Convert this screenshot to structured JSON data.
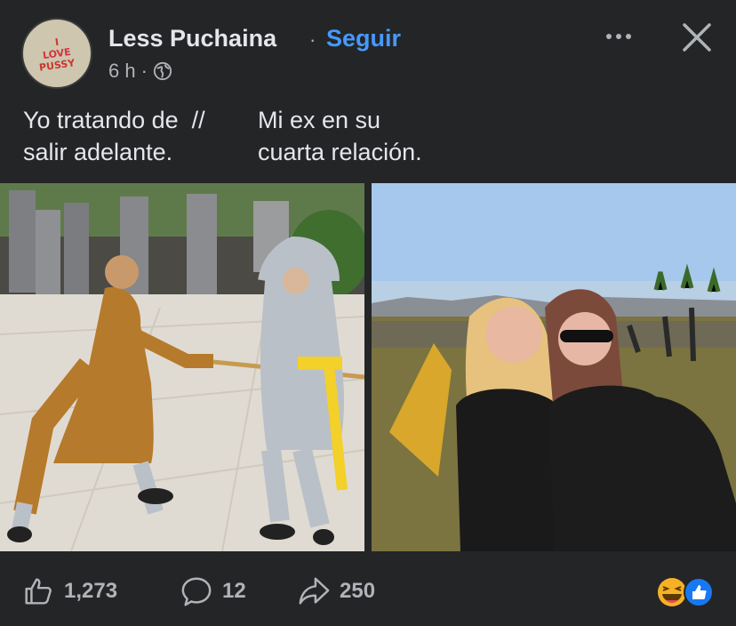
{
  "post": {
    "author": "Less Puchaina",
    "separator": "·",
    "follow_label": "Seguir",
    "time": "6 h",
    "time_separator": "·",
    "avatar_text": [
      "I",
      "LOVE",
      "PUSSY"
    ],
    "caption_left_line1": "Yo tratando de",
    "caption_left_line2": "salir adelante.",
    "caption_divider": "//",
    "caption_right_line1": "Mi ex en su",
    "caption_right_line2": "cuarta relación."
  },
  "stats": {
    "likes": "1,273",
    "comments": "12",
    "shares": "250"
  },
  "colors": {
    "background": "#242526",
    "follow": "#4599ff",
    "text": "#e4e6eb",
    "secondary": "#b0b3b8",
    "like_badge": "#1877f2",
    "haha_badge": "#f7b125"
  },
  "icons": [
    "globe-icon",
    "more-options-icon",
    "close-icon",
    "like-icon",
    "comment-icon",
    "share-icon",
    "haha-reaction-icon",
    "like-reaction-icon"
  ]
}
